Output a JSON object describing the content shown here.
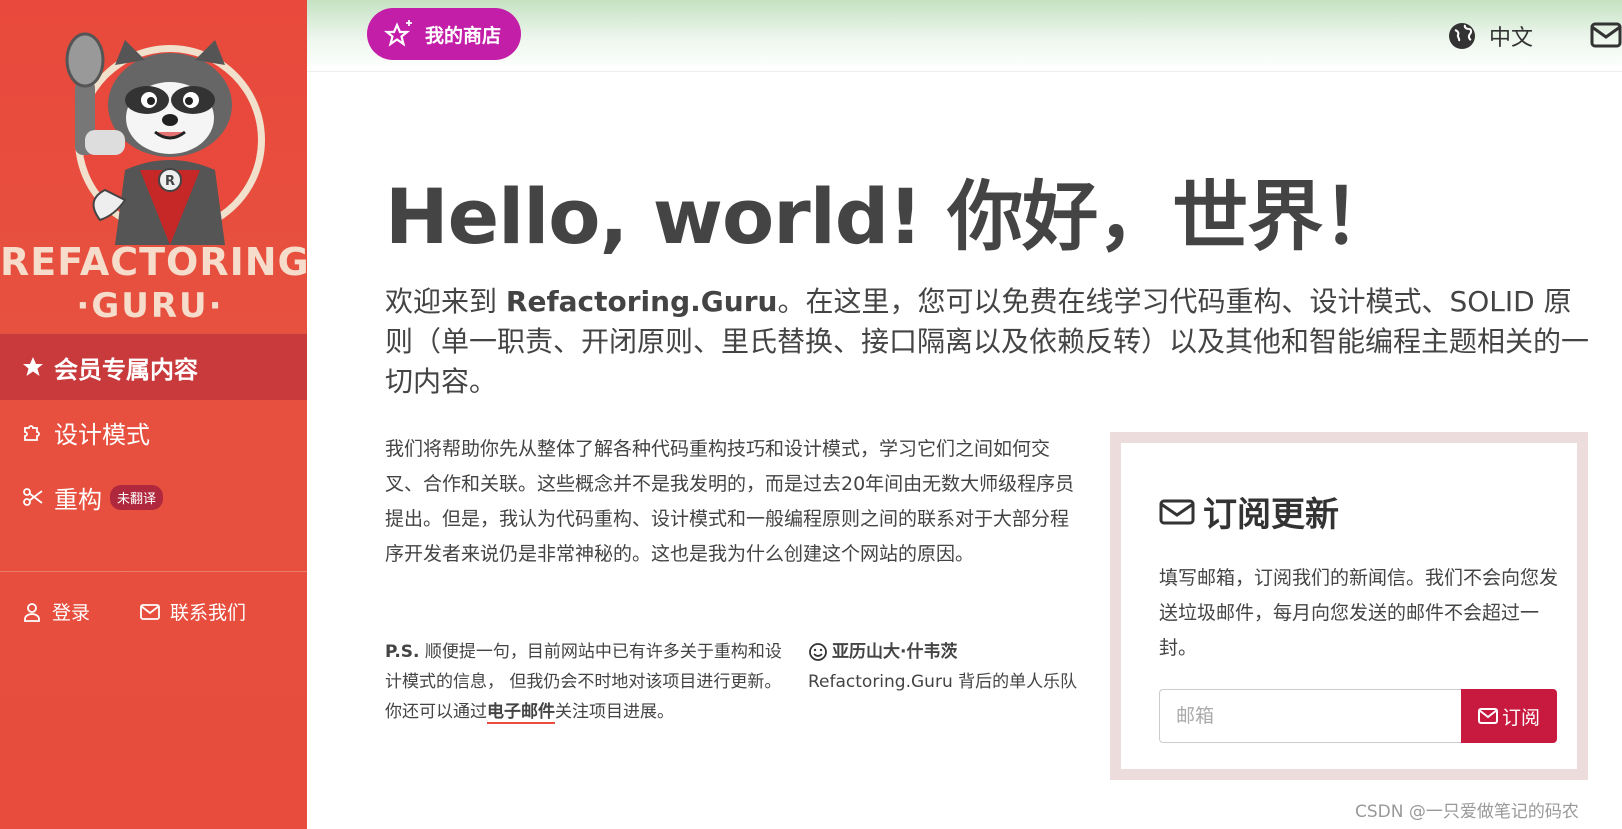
{
  "sidebar": {
    "logo_line1": "REFACTORING",
    "logo_line2": "·GURU·",
    "nav": [
      {
        "label": "会员专属内容",
        "icon": "star-icon"
      },
      {
        "label": "设计模式",
        "icon": "puzzle-icon"
      },
      {
        "label": "重构",
        "icon": "scissors-icon",
        "badge": "未翻译"
      }
    ],
    "login_label": "登录",
    "contact_label": "联系我们"
  },
  "topbar": {
    "shop_label": "我的商店",
    "language_label": "中文"
  },
  "main": {
    "headline": "Hello, world! 你好，世界！",
    "intro_pre": "欢迎来到 ",
    "intro_brand": "Refactoring.Guru",
    "intro_post": "。在这里，您可以免费在线学习代码重构、设计模式、SOLID 原则（单一职责、开闭原则、里氏替换、接口隔离以及依赖反转）以及其他和智能编程主题相关的一切内容。",
    "body": "我们将帮助你先从整体了解各种代码重构技巧和设计模式，学习它们之间如何交叉、合作和关联。这些概念并不是我发明的，而是过去20年间由无数大师级程序员提出。但是，我认为代码重构、设计模式和一般编程原则之间的联系对于大部分程序开发者来说仍是非常神秘的。这也是我为什么创建这个网站的原因。",
    "ps_prefix": "P.S.",
    "ps_text": " 顺便提一句，目前网站中已有许多关于重构和设计模式的信息， 但我仍会不时地对该项目进行更新。你还可以通过",
    "ps_link": "电子邮件",
    "ps_suffix": "关注项目进展。",
    "author_name": "亚历山大·什韦茨",
    "author_role": "Refactoring.Guru 背后的单人乐队"
  },
  "subscribe": {
    "title": "订阅更新",
    "description": "填写邮箱，订阅我们的新闻信。我们不会向您发送垃圾邮件，每月向您发送的邮件不会超过一封。",
    "placeholder": "邮箱",
    "button_label": "订阅"
  },
  "watermark": "CSDN @一只爱做笔记的码农",
  "colors": {
    "sidebar_bg": "#e74c3c",
    "active_nav": "#c93a3d",
    "shop_button": "#c31ea8",
    "subscribe_button": "#c8193e",
    "subscribe_border": "#ecdcdc"
  }
}
